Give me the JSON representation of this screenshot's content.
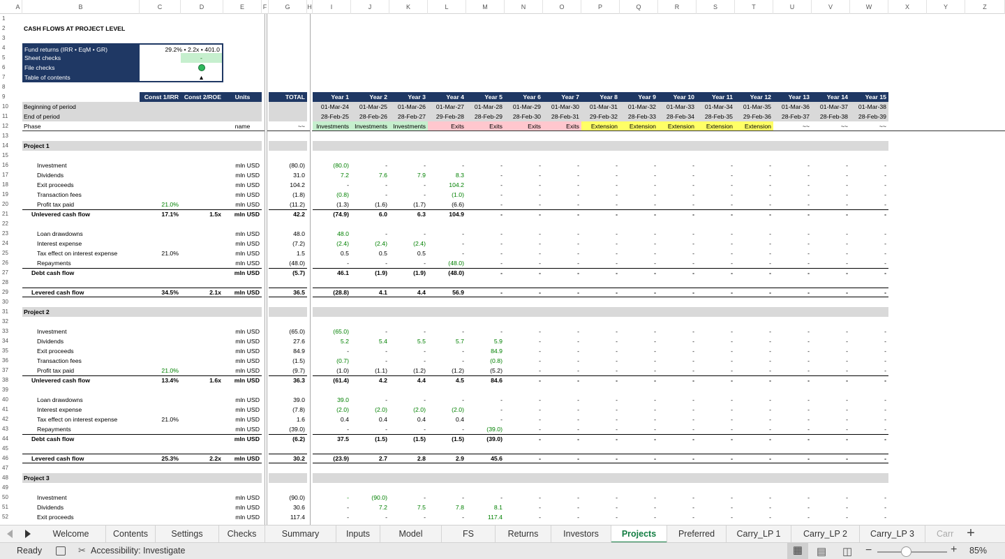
{
  "columns": [
    "A",
    "B",
    "C",
    "D",
    "E",
    "F",
    "G",
    "H",
    "I",
    "J",
    "K",
    "L",
    "M",
    "N",
    "O",
    "P",
    "Q",
    "R",
    "S",
    "T",
    "U",
    "V",
    "W",
    "X",
    "Y",
    "Z"
  ],
  "title": "CASH FLOWS AT PROJECT LEVEL",
  "fund_box": {
    "labels": [
      "Fund returns (IRR • EqM • GR)",
      "Sheet checks",
      "File checks",
      "Table of contents"
    ],
    "fund_returns_value": "29.2% • 2.2x • 401.0",
    "sheet_checks_value": "-",
    "toc_glyph": "▲"
  },
  "headers": {
    "const1": "Const 1/IRR",
    "const2": "Const 2/ROE",
    "units": "Units",
    "total": "TOTAL",
    "years": [
      "Year 1",
      "Year 2",
      "Year 3",
      "Year 4",
      "Year 5",
      "Year 6",
      "Year 7",
      "Year 8",
      "Year 9",
      "Year 10",
      "Year 11",
      "Year 12",
      "Year 13",
      "Year 14",
      "Year 15"
    ],
    "beginning_label": "Beginning of period",
    "end_label": "End of period",
    "phase_label": "Phase",
    "phase_units": "name",
    "phase_total": "~~",
    "begin_dates": [
      "01-Mar-24",
      "01-Mar-25",
      "01-Mar-26",
      "01-Mar-27",
      "01-Mar-28",
      "01-Mar-29",
      "01-Mar-30",
      "01-Mar-31",
      "01-Mar-32",
      "01-Mar-33",
      "01-Mar-34",
      "01-Mar-35",
      "01-Mar-36",
      "01-Mar-37",
      "01-Mar-38"
    ],
    "end_dates": [
      "28-Feb-25",
      "28-Feb-26",
      "28-Feb-27",
      "29-Feb-28",
      "28-Feb-29",
      "28-Feb-30",
      "28-Feb-31",
      "29-Feb-32",
      "28-Feb-33",
      "28-Feb-34",
      "28-Feb-35",
      "29-Feb-36",
      "28-Feb-37",
      "28-Feb-38",
      "28-Feb-39"
    ],
    "phases": [
      "Investments",
      "Investments",
      "Investments",
      "Exits",
      "Exits",
      "Exits",
      "Exits",
      "Extension",
      "Extension",
      "Extension",
      "Extension",
      "Extension",
      "~~",
      "~~",
      "~~"
    ],
    "phase_colors": {
      "Investments": "#c6efce",
      "Exits": "#ffc7ce",
      "Extension": "#ffff66",
      "~~": "#ffffff"
    }
  },
  "rows": [
    {
      "n": 14,
      "kind": "section",
      "label": "Project 1"
    },
    {
      "n": 16,
      "kind": "item",
      "label": "Investment",
      "units": "mln USD",
      "total": "(80.0)",
      "vals": [
        "(80.0)",
        "-",
        "-",
        "-",
        "-",
        "-",
        "-",
        "-",
        "-",
        "-",
        "-",
        "-",
        "-",
        "-",
        "-"
      ],
      "green": [
        0
      ]
    },
    {
      "n": 17,
      "kind": "item",
      "label": "Dividends",
      "units": "mln USD",
      "total": "31.0",
      "vals": [
        "7.2",
        "7.6",
        "7.9",
        "8.3",
        "-",
        "-",
        "-",
        "-",
        "-",
        "-",
        "-",
        "-",
        "-",
        "-",
        "-"
      ],
      "green": [
        0,
        1,
        2,
        3
      ]
    },
    {
      "n": 18,
      "kind": "item",
      "label": "Exit proceeds",
      "units": "mln USD",
      "total": "104.2",
      "vals": [
        "-",
        "-",
        "-",
        "104.2",
        "-",
        "-",
        "-",
        "-",
        "-",
        "-",
        "-",
        "-",
        "-",
        "-",
        "-"
      ],
      "green": [
        3
      ]
    },
    {
      "n": 19,
      "kind": "item",
      "label": "Transaction fees",
      "units": "mln USD",
      "total": "(1.8)",
      "vals": [
        "(0.8)",
        "-",
        "-",
        "(1.0)",
        "-",
        "-",
        "-",
        "-",
        "-",
        "-",
        "-",
        "-",
        "-",
        "-",
        "-"
      ],
      "green": [
        0,
        3
      ]
    },
    {
      "n": 20,
      "kind": "item",
      "label": "Profit tax paid",
      "c": "21.0%",
      "cgreen": true,
      "units": "mln USD",
      "total": "(11.2)",
      "vals": [
        "(1.3)",
        "(1.6)",
        "(1.7)",
        "(6.6)",
        "-",
        "-",
        "-",
        "-",
        "-",
        "-",
        "-",
        "-",
        "-",
        "-",
        "-"
      ]
    },
    {
      "n": 21,
      "kind": "total",
      "label": "Unlevered cash flow",
      "c": "17.1%",
      "d": "1.5x",
      "units": "mln USD",
      "total": "42.2",
      "vals": [
        "(74.9)",
        "6.0",
        "6.3",
        "104.9",
        "-",
        "-",
        "-",
        "-",
        "-",
        "-",
        "-",
        "-",
        "-",
        "-",
        "-"
      ]
    },
    {
      "n": 23,
      "kind": "item",
      "label": "Loan drawdowns",
      "units": "mln USD",
      "total": "48.0",
      "vals": [
        "48.0",
        "-",
        "-",
        "-",
        "-",
        "-",
        "-",
        "-",
        "-",
        "-",
        "-",
        "-",
        "-",
        "-",
        "-"
      ],
      "green": [
        0
      ]
    },
    {
      "n": 24,
      "kind": "item",
      "label": "Interest expense",
      "units": "mln USD",
      "total": "(7.2)",
      "vals": [
        "(2.4)",
        "(2.4)",
        "(2.4)",
        "-",
        "-",
        "-",
        "-",
        "-",
        "-",
        "-",
        "-",
        "-",
        "-",
        "-",
        "-"
      ],
      "green": [
        0,
        1,
        2
      ]
    },
    {
      "n": 25,
      "kind": "item",
      "label": "Tax effect on interest expense",
      "c": "21.0%",
      "units": "mln USD",
      "total": "1.5",
      "vals": [
        "0.5",
        "0.5",
        "0.5",
        "-",
        "-",
        "-",
        "-",
        "-",
        "-",
        "-",
        "-",
        "-",
        "-",
        "-",
        "-"
      ]
    },
    {
      "n": 26,
      "kind": "item",
      "label": "Repayments",
      "units": "mln USD",
      "total": "(48.0)",
      "vals": [
        "-",
        "-",
        "-",
        "(48.0)",
        "-",
        "-",
        "-",
        "-",
        "-",
        "-",
        "-",
        "-",
        "-",
        "-",
        "-"
      ],
      "green": [
        3
      ]
    },
    {
      "n": 27,
      "kind": "total",
      "label": "Debt cash flow",
      "units": "mln USD",
      "total": "(5.7)",
      "vals": [
        "46.1",
        "(1.9)",
        "(1.9)",
        "(48.0)",
        "-",
        "-",
        "-",
        "-",
        "-",
        "-",
        "-",
        "-",
        "-",
        "-",
        "-"
      ]
    },
    {
      "n": 29,
      "kind": "lev",
      "label": "Levered cash flow",
      "c": "34.5%",
      "d": "2.1x",
      "units": "mln USD",
      "total": "36.5",
      "vals": [
        "(28.8)",
        "4.1",
        "4.4",
        "56.9",
        "-",
        "-",
        "-",
        "-",
        "-",
        "-",
        "-",
        "-",
        "-",
        "-",
        "-"
      ]
    },
    {
      "n": 31,
      "kind": "section",
      "label": "Project 2"
    },
    {
      "n": 33,
      "kind": "item",
      "label": "Investment",
      "units": "mln USD",
      "total": "(65.0)",
      "vals": [
        "(65.0)",
        "-",
        "-",
        "-",
        "-",
        "-",
        "-",
        "-",
        "-",
        "-",
        "-",
        "-",
        "-",
        "-",
        "-"
      ],
      "green": [
        0
      ]
    },
    {
      "n": 34,
      "kind": "item",
      "label": "Dividends",
      "units": "mln USD",
      "total": "27.6",
      "vals": [
        "5.2",
        "5.4",
        "5.5",
        "5.7",
        "5.9",
        "-",
        "-",
        "-",
        "-",
        "-",
        "-",
        "-",
        "-",
        "-",
        "-"
      ],
      "green": [
        0,
        1,
        2,
        3,
        4
      ]
    },
    {
      "n": 35,
      "kind": "item",
      "label": "Exit proceeds",
      "units": "mln USD",
      "total": "84.9",
      "vals": [
        "-",
        "-",
        "-",
        "-",
        "84.9",
        "-",
        "-",
        "-",
        "-",
        "-",
        "-",
        "-",
        "-",
        "-",
        "-"
      ],
      "green": [
        4
      ]
    },
    {
      "n": 36,
      "kind": "item",
      "label": "Transaction fees",
      "units": "mln USD",
      "total": "(1.5)",
      "vals": [
        "(0.7)",
        "-",
        "-",
        "-",
        "(0.8)",
        "-",
        "-",
        "-",
        "-",
        "-",
        "-",
        "-",
        "-",
        "-",
        "-"
      ],
      "green": [
        0,
        4
      ]
    },
    {
      "n": 37,
      "kind": "item",
      "label": "Profit tax paid",
      "c": "21.0%",
      "cgreen": true,
      "units": "mln USD",
      "total": "(9.7)",
      "vals": [
        "(1.0)",
        "(1.1)",
        "(1.2)",
        "(1.2)",
        "(5.2)",
        "-",
        "-",
        "-",
        "-",
        "-",
        "-",
        "-",
        "-",
        "-",
        "-"
      ]
    },
    {
      "n": 38,
      "kind": "total",
      "label": "Unlevered cash flow",
      "c": "13.4%",
      "d": "1.6x",
      "units": "mln USD",
      "total": "36.3",
      "vals": [
        "(61.4)",
        "4.2",
        "4.4",
        "4.5",
        "84.6",
        "-",
        "-",
        "-",
        "-",
        "-",
        "-",
        "-",
        "-",
        "-",
        "-"
      ]
    },
    {
      "n": 40,
      "kind": "item",
      "label": "Loan drawdowns",
      "units": "mln USD",
      "total": "39.0",
      "vals": [
        "39.0",
        "-",
        "-",
        "-",
        "-",
        "-",
        "-",
        "-",
        "-",
        "-",
        "-",
        "-",
        "-",
        "-",
        "-"
      ],
      "green": [
        0
      ]
    },
    {
      "n": 41,
      "kind": "item",
      "label": "Interest expense",
      "units": "mln USD",
      "total": "(7.8)",
      "vals": [
        "(2.0)",
        "(2.0)",
        "(2.0)",
        "(2.0)",
        "-",
        "-",
        "-",
        "-",
        "-",
        "-",
        "-",
        "-",
        "-",
        "-",
        "-"
      ],
      "green": [
        0,
        1,
        2,
        3
      ]
    },
    {
      "n": 42,
      "kind": "item",
      "label": "Tax effect on interest expense",
      "c": "21.0%",
      "units": "mln USD",
      "total": "1.6",
      "vals": [
        "0.4",
        "0.4",
        "0.4",
        "0.4",
        "-",
        "-",
        "-",
        "-",
        "-",
        "-",
        "-",
        "-",
        "-",
        "-",
        "-"
      ]
    },
    {
      "n": 43,
      "kind": "item",
      "label": "Repayments",
      "units": "mln USD",
      "total": "(39.0)",
      "vals": [
        "-",
        "-",
        "-",
        "-",
        "(39.0)",
        "-",
        "-",
        "-",
        "-",
        "-",
        "-",
        "-",
        "-",
        "-",
        "-"
      ],
      "green": [
        4
      ]
    },
    {
      "n": 44,
      "kind": "total",
      "label": "Debt cash flow",
      "units": "mln USD",
      "total": "(6.2)",
      "vals": [
        "37.5",
        "(1.5)",
        "(1.5)",
        "(1.5)",
        "(39.0)",
        "-",
        "-",
        "-",
        "-",
        "-",
        "-",
        "-",
        "-",
        "-",
        "-"
      ]
    },
    {
      "n": 46,
      "kind": "lev",
      "label": "Levered cash flow",
      "c": "25.3%",
      "d": "2.2x",
      "units": "mln USD",
      "total": "30.2",
      "vals": [
        "(23.9)",
        "2.7",
        "2.8",
        "2.9",
        "45.6",
        "-",
        "-",
        "-",
        "-",
        "-",
        "-",
        "-",
        "-",
        "-",
        "-"
      ]
    },
    {
      "n": 48,
      "kind": "section",
      "label": "Project 3"
    },
    {
      "n": 50,
      "kind": "item",
      "label": "Investment",
      "units": "mln USD",
      "total": "(90.0)",
      "vals": [
        "-",
        "(90.0)",
        "-",
        "-",
        "-",
        "-",
        "-",
        "-",
        "-",
        "-",
        "-",
        "-",
        "-",
        "-",
        "-"
      ],
      "green": [
        0,
        1
      ]
    },
    {
      "n": 51,
      "kind": "item",
      "label": "Dividends",
      "units": "mln USD",
      "total": "30.6",
      "vals": [
        "-",
        "7.2",
        "7.5",
        "7.8",
        "8.1",
        "-",
        "-",
        "-",
        "-",
        "-",
        "-",
        "-",
        "-",
        "-",
        "-"
      ],
      "green": [
        1,
        2,
        3,
        4
      ]
    },
    {
      "n": 52,
      "kind": "item",
      "label": "Exit proceeds",
      "units": "mln USD",
      "total": "117.4",
      "vals": [
        "-",
        "-",
        "-",
        "-",
        "117.4",
        "-",
        "-",
        "-",
        "-",
        "-",
        "-",
        "-",
        "-",
        "-",
        "-"
      ],
      "green": [
        4
      ]
    }
  ],
  "tabs": [
    "Welcome",
    "Contents",
    "Settings",
    "Checks",
    "Summary",
    "Inputs",
    "Model",
    "FS",
    "Returns",
    "Investors",
    "Projects",
    "Preferred",
    "Carry_LP 1",
    "Carry_LP 2",
    "Carry_LP 3",
    "Carr"
  ],
  "active_tab": "Projects",
  "status": {
    "ready": "Ready",
    "accessibility": "Accessibility: Investigate",
    "zoom": "85%"
  },
  "colors": {
    "navy": "#1f3864",
    "section_gray": "#d9d9d9",
    "green_text": "#008000",
    "active_tab": "#137e43"
  }
}
